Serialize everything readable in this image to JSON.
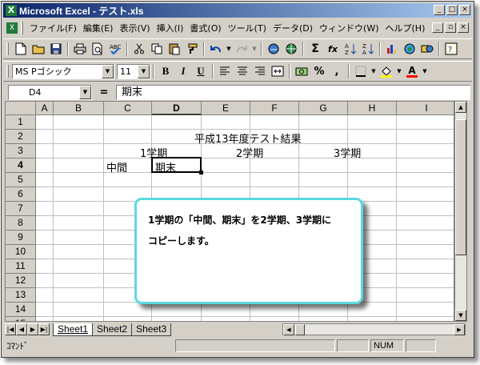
{
  "window": {
    "app_icon_text": "X",
    "title": "Microsoft Excel - テスト.xls",
    "controls": [
      "_",
      "□",
      "×"
    ]
  },
  "menubar": {
    "items": [
      "ファイル(F)",
      "編集(E)",
      "表示(V)",
      "挿入(I)",
      "書式(O)",
      "ツール(T)",
      "データ(D)",
      "ウィンドウ(W)",
      "ヘルプ(H)"
    ],
    "doc_controls": [
      "_",
      "▫",
      "×"
    ]
  },
  "toolbar": {
    "font_name": "MS Pゴシック",
    "font_size": "11",
    "bold": "B",
    "italic": "I",
    "underline": "U",
    "percent": "%",
    "comma": ",",
    "sigma": "Σ",
    "fx": "fx",
    "font_color_letter": "A"
  },
  "formula_bar": {
    "name_box": "D4",
    "equals": "=",
    "content": "期末"
  },
  "sheet": {
    "columns": [
      "A",
      "B",
      "C",
      "D",
      "E",
      "F",
      "G",
      "H",
      "I"
    ],
    "active_column": "D",
    "rows": [
      "1",
      "2",
      "3",
      "4",
      "5",
      "6",
      "7",
      "8",
      "9",
      "10",
      "11",
      "12",
      "13",
      "14",
      "15"
    ],
    "active_row": "4",
    "cells": {
      "title": "平成13年度テスト結果",
      "term1": "1学期",
      "term2": "2学期",
      "term3": "3学期",
      "midterm": "中間",
      "final": "期末"
    }
  },
  "tabs": [
    "Sheet1",
    "Sheet2",
    "Sheet3"
  ],
  "active_tab": "Sheet1",
  "status": {
    "mode": "ｺﾏﾝﾄﾞ",
    "num": "NUM"
  },
  "callout": {
    "line1": "1学期の「中間、期末」を2学期、3学期に",
    "line2": "コピーします。"
  }
}
